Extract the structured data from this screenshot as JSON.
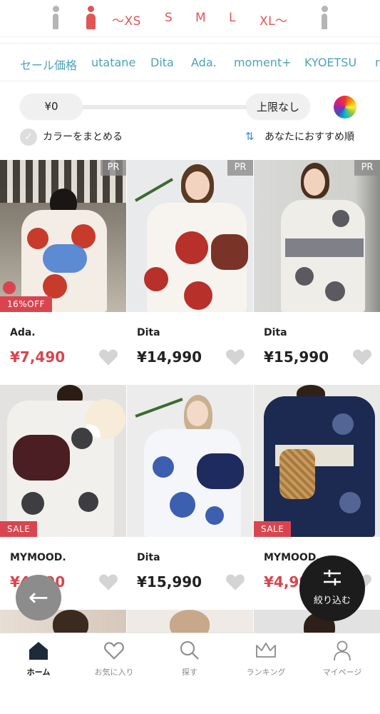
{
  "size_filter": {
    "sizes": [
      "〜XS",
      "S",
      "M",
      "L",
      "XL〜"
    ],
    "colors": {
      "accent": "#e05555",
      "inactive": "#b5b5b5"
    }
  },
  "brands": [
    "セール価格",
    "utatane",
    "Dita",
    "Ada.",
    "moment+",
    "KYOETSU",
    "r"
  ],
  "price_filter": {
    "min": "¥0",
    "max": "上限なし"
  },
  "options": {
    "group_colors": "カラーをまとめる",
    "sort": "あなたにおすすめ順"
  },
  "products": [
    {
      "brand": "Ada.",
      "price": "¥7,490",
      "price_color": "#d9454f",
      "badge": "16%OFF",
      "pr": "PR"
    },
    {
      "brand": "Dita",
      "price": "¥14,990",
      "price_color": "#222222",
      "badge": "",
      "pr": "PR"
    },
    {
      "brand": "Dita",
      "price": "¥15,990",
      "price_color": "#222222",
      "badge": "",
      "pr": "PR"
    },
    {
      "brand": "MYMOOD.",
      "price": "¥4,990",
      "price_color": "#d9454f",
      "badge": "SALE",
      "pr": ""
    },
    {
      "brand": "Dita",
      "price": "¥15,990",
      "price_color": "#222222",
      "badge": "",
      "pr": ""
    },
    {
      "brand": "MYMOOD.",
      "price": "¥4,990",
      "price_color": "#d9454f",
      "badge": "SALE",
      "pr": ""
    }
  ],
  "floating": {
    "filter_label": "絞り込む"
  },
  "bottom_nav": [
    {
      "label": "ホーム",
      "icon": "home-icon",
      "active": true
    },
    {
      "label": "お気に入り",
      "icon": "heart-icon",
      "active": false
    },
    {
      "label": "探す",
      "icon": "search-icon",
      "active": false
    },
    {
      "label": "ランキング",
      "icon": "crown-icon",
      "active": false
    },
    {
      "label": "マイページ",
      "icon": "user-icon",
      "active": false
    }
  ]
}
